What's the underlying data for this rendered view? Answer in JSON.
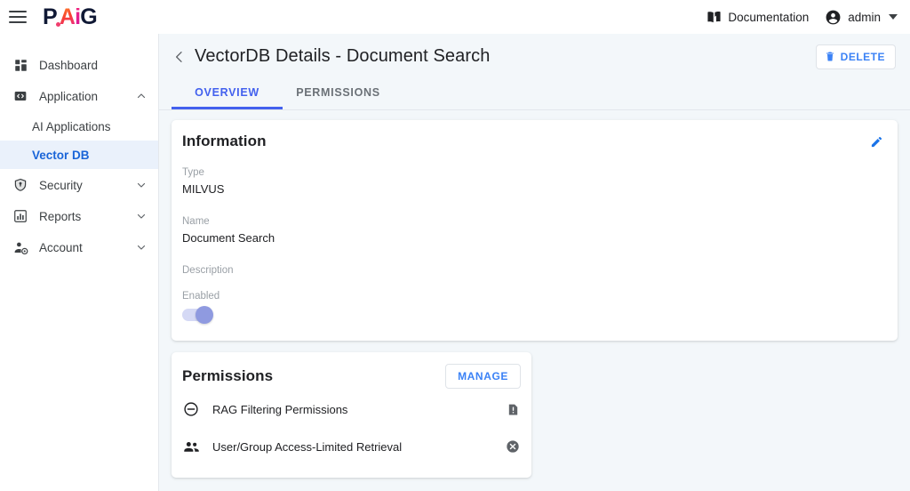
{
  "topbar": {
    "menu_icon": "hamburger-menu-icon",
    "logo": {
      "p": "P",
      "a": "A",
      "i": "i",
      "g": "G",
      "alt": "PAIG"
    },
    "documentation_label": "Documentation",
    "documentation_icon": "book-icon",
    "user_label": "admin",
    "user_icon": "account-circle-icon",
    "user_caret_icon": "chevron-down-icon"
  },
  "sidebar": {
    "items": [
      {
        "label": "Dashboard",
        "icon": "dashboard-icon",
        "expandable": false,
        "active": false
      },
      {
        "label": "Application",
        "icon": "code-box-icon",
        "expandable": true,
        "expanded": true,
        "active": false
      },
      {
        "label": "Security",
        "icon": "shield-icon",
        "expandable": true,
        "expanded": false,
        "active": false
      },
      {
        "label": "Reports",
        "icon": "bar-chart-icon",
        "expandable": true,
        "expanded": false,
        "active": false
      },
      {
        "label": "Account",
        "icon": "person-gear-icon",
        "expandable": true,
        "expanded": false,
        "active": false
      }
    ],
    "sub_items": [
      {
        "label": "AI Applications",
        "active": false
      },
      {
        "label": "Vector DB",
        "active": true
      }
    ]
  },
  "page": {
    "back_icon": "chevron-left-icon",
    "title": "VectorDB Details - Document Search",
    "delete_label": "DELETE",
    "delete_icon": "trash-icon"
  },
  "tabs": [
    {
      "label": "OVERVIEW",
      "active": true
    },
    {
      "label": "PERMISSIONS",
      "active": false
    }
  ],
  "information": {
    "title": "Information",
    "edit_icon": "pencil-icon",
    "fields": [
      {
        "label": "Type",
        "value": "MILVUS"
      },
      {
        "label": "Name",
        "value": "Document Search"
      },
      {
        "label": "Description",
        "value": ""
      }
    ],
    "enabled_label": "Enabled",
    "enabled_value": true
  },
  "permissions": {
    "title": "Permissions",
    "manage_label": "MANAGE",
    "rows": [
      {
        "label": "RAG Filtering Permissions",
        "icon": "block-circle-icon",
        "status_icon": "warning-badge-icon"
      },
      {
        "label": "User/Group Access-Limited Retrieval",
        "icon": "group-people-icon",
        "status_icon": "cancel-circle-icon"
      }
    ]
  },
  "colors": {
    "accent_blue": "#4361ee",
    "link_blue": "#3b82f6",
    "active_nav_blue": "#1a65d8",
    "active_nav_bg": "#eaf1fb",
    "page_bg": "#f3f7fa",
    "toggle_track": "#d5d9f5",
    "toggle_knob": "#8f9ae0",
    "status_gray": "#5f6368"
  }
}
